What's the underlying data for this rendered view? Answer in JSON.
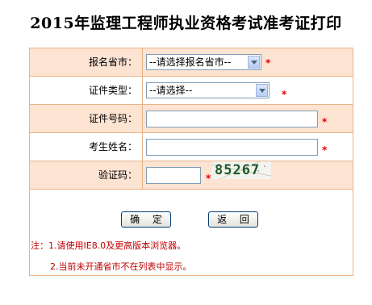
{
  "page": {
    "title": "2015年监理工程师执业资格考试准考证打印"
  },
  "form": {
    "province": {
      "label": "报名省市：",
      "selected": "--请选择报名省市--"
    },
    "id_type": {
      "label": "证件类型：",
      "selected": "--请选择--"
    },
    "id_number": {
      "label": "证件号码：",
      "value": ""
    },
    "name": {
      "label": "考生姓名：",
      "value": ""
    },
    "captcha": {
      "label": "验证码：",
      "value": "",
      "image_text": "85267"
    },
    "required_mark": "*"
  },
  "buttons": {
    "confirm": "确 定",
    "back": "返 回"
  },
  "notes": {
    "line1": "注：1.请使用IE8.0及更高版本浏览器。",
    "line2": "2.当前未开通省市不在列表中显示。"
  },
  "colors": {
    "border": "#e8b489",
    "row_shade": "#fde3d2",
    "required": "#e00000",
    "note": "#c00000"
  }
}
